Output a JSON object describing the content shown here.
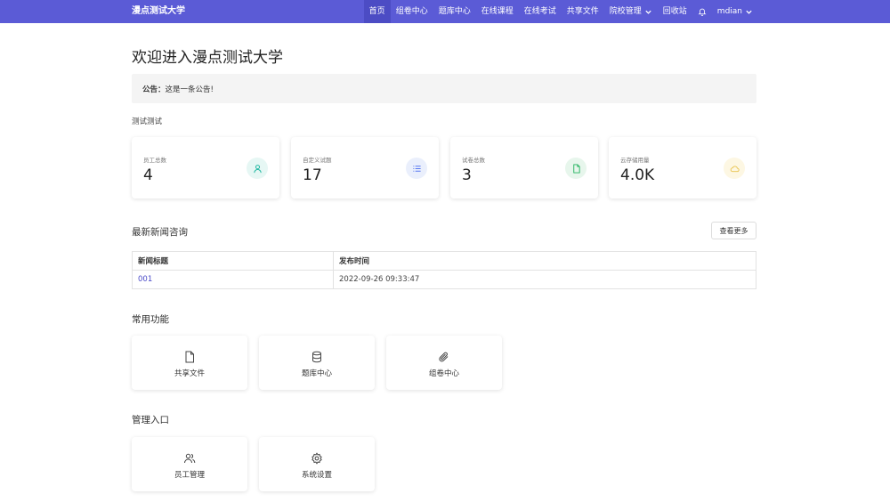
{
  "nav": {
    "brand": "漫点测试大学",
    "items": [
      {
        "label": "首页"
      },
      {
        "label": "组卷中心"
      },
      {
        "label": "题库中心"
      },
      {
        "label": "在线课程"
      },
      {
        "label": "在线考试"
      },
      {
        "label": "共享文件"
      },
      {
        "label": "院校管理"
      },
      {
        "label": "回收站"
      }
    ],
    "user": "mdian"
  },
  "page": {
    "title": "欢迎进入漫点测试大学",
    "notice_label": "公告：",
    "notice_text": "这是一条公告!",
    "subtext": "测试测试"
  },
  "stats": [
    {
      "label": "员工总数",
      "value": "4",
      "icon": "user-icon",
      "color": "#12b39b",
      "bg": "#e6f7f4"
    },
    {
      "label": "自定义试题",
      "value": "17",
      "icon": "list-icon",
      "color": "#4a6cf0",
      "bg": "#eaeffc"
    },
    {
      "label": "试卷总数",
      "value": "3",
      "icon": "file-icon",
      "color": "#22b35e",
      "bg": "#e7f6ec"
    },
    {
      "label": "云存储用量",
      "value": "4.0K",
      "icon": "cloud-icon",
      "color": "#e8c24a",
      "bg": "#fdf7e3"
    }
  ],
  "news": {
    "title": "最新新闻咨询",
    "more_label": "查看更多",
    "columns": [
      "新闻标题",
      "发布时间"
    ],
    "rows": [
      {
        "title": "001",
        "time": "2022-09-26 09:33:47"
      }
    ]
  },
  "common": {
    "title": "常用功能",
    "items": [
      {
        "label": "共享文件",
        "icon": "file-icon"
      },
      {
        "label": "题库中心",
        "icon": "database-icon"
      },
      {
        "label": "组卷中心",
        "icon": "paperclip-icon"
      }
    ]
  },
  "admin": {
    "title": "管理入口",
    "items": [
      {
        "label": "员工管理",
        "icon": "users-icon"
      },
      {
        "label": "系统设置",
        "icon": "gear-icon"
      }
    ]
  }
}
